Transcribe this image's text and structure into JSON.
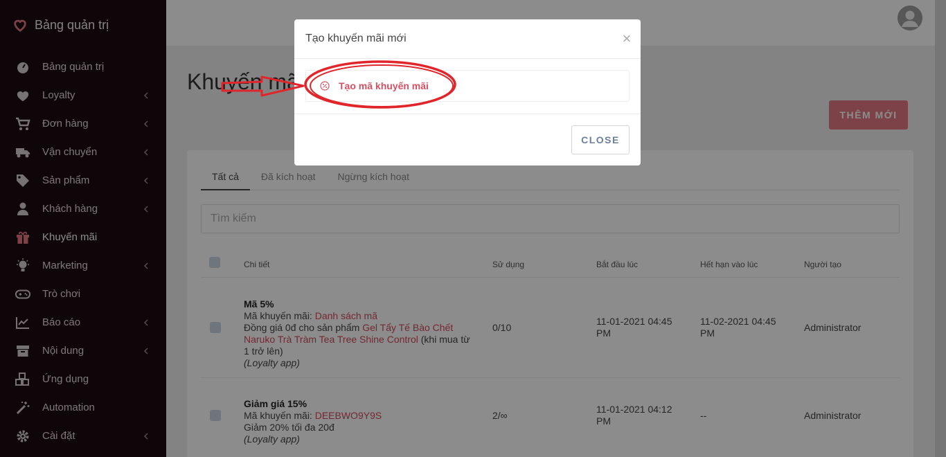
{
  "sidebar": {
    "brand": "Bảng quản trị",
    "items": [
      {
        "label": "Bảng quản trị",
        "icon": "dashboard-icon"
      },
      {
        "label": "Loyalty",
        "icon": "heart-icon"
      },
      {
        "label": "Đơn hàng",
        "icon": "cart-icon"
      },
      {
        "label": "Vận chuyển",
        "icon": "truck-icon"
      },
      {
        "label": "Sản phẩm",
        "icon": "tag-icon"
      },
      {
        "label": "Khách hàng",
        "icon": "user-icon"
      },
      {
        "label": "Khuyến mãi",
        "icon": "gift-icon"
      },
      {
        "label": "Marketing",
        "icon": "lightbulb-icon"
      },
      {
        "label": "Trò chơi",
        "icon": "gamepad-icon"
      },
      {
        "label": "Báo cáo",
        "icon": "chart-icon"
      },
      {
        "label": "Nội dung",
        "icon": "archive-icon"
      },
      {
        "label": "Ứng dụng",
        "icon": "cubes-icon"
      },
      {
        "label": "Automation",
        "icon": "magic-wand-icon"
      },
      {
        "label": "Cài đặt",
        "icon": "gear-icon"
      }
    ]
  },
  "page": {
    "title": "Khuyến mãi",
    "add_button": "THÊM MỚI"
  },
  "tabs": [
    "Tất cả",
    "Đã kích hoạt",
    "Ngừng kích hoạt"
  ],
  "search": {
    "placeholder": "Tìm kiếm"
  },
  "table": {
    "headers": [
      "Chi tiết",
      "Sử dụng",
      "Bắt đầu lúc",
      "Hết hạn vào lúc",
      "Người tạo"
    ],
    "rows": [
      {
        "name": "Mã 5%",
        "code_label": "Mã khuyến mãi: ",
        "code": "Danh sách mã",
        "desc_pre": "Đồng giá 0đ cho sản phẩm ",
        "desc_link": "Gel Tẩy Tế Bào Chết Naruko Trà Tràm Tea Tree Shine Control",
        "desc_post": " (khi mua từ 1 trở lên)",
        "source": "(Loyalty app)",
        "usage": "0/10",
        "start": "11-01-2021 04:45 PM",
        "end": "11-02-2021 04:45 PM",
        "creator": "Administrator"
      },
      {
        "name": "Giảm giá 15%",
        "code_label": "Mã khuyến mãi: ",
        "code": "DEEBWO9Y9S",
        "desc": "Giảm 20% tối đa 20đ",
        "source": "(Loyalty app)",
        "usage": "2/∞",
        "start": "11-01-2021 04:12 PM",
        "end": "--",
        "creator": "Administrator"
      }
    ]
  },
  "modal": {
    "title": "Tạo khuyến mãi mới",
    "close_x": "×",
    "option_label": "Tạo mã khuyến mãi",
    "close_button": "CLOSE"
  },
  "colors": {
    "sidebar_bg": "#1b0b10",
    "accent": "#e37884",
    "link": "#d04a5c",
    "annotation": "#e0252b"
  }
}
